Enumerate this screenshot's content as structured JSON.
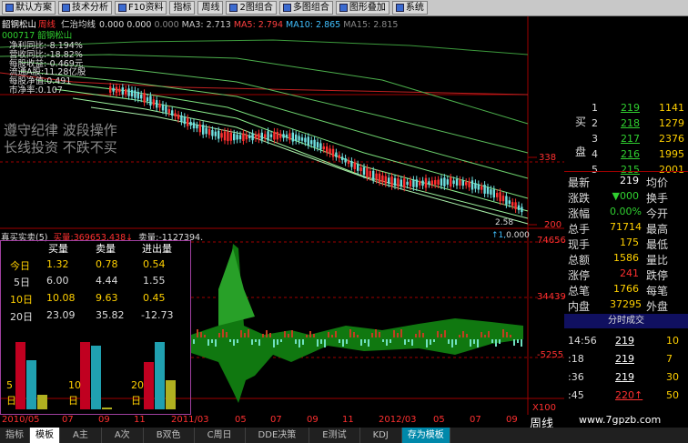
{
  "toolbar": {
    "items": [
      "默认方案",
      "技术分析",
      "F10资料",
      "指标",
      "周线",
      "2图组合",
      "多图组合",
      "图形叠加",
      "系统"
    ]
  },
  "header": {
    "name": "韶钢松山",
    "period": "周线",
    "ma_label": "仁治均线",
    "v1": "0.000",
    "v2": "0.000",
    "v3": "0.000",
    "ma3": "MA3: 2.713",
    "ma5": "MA5: 2.794",
    "ma10": "MA10: 2.865",
    "ma15": "MA15: 2.815"
  },
  "subheader": {
    "code": "000717",
    "name": "韶钢松山"
  },
  "fundamentals": [
    "净利同比:-8.194%",
    "营收同比:-18.82%",
    "每股收益:-0.469元",
    "流通A股:11.28亿股",
    "每股净值:0.491",
    "市净率:0.107"
  ],
  "watermark": {
    "line1": "遵守纪律 波段操作",
    "line2": "长线投资 不跌不买"
  },
  "price_axis": {
    "p338": "338",
    "p200": "200",
    "p74656": "74656",
    "p34439": "34439",
    "pneg": "-5255",
    "x100": "X100"
  },
  "mid_labels": {
    "a": "2.58",
    "b": "0.000"
  },
  "buysell": {
    "title": "真买实卖(5)",
    "buy_label": "买量:",
    "buy_val": "369653.438↓",
    "sell_label": "卖量:",
    "sell_val": "-1127394.",
    "headers": [
      "买量",
      "卖量",
      "进出量"
    ],
    "rows": [
      {
        "label": "今日",
        "buy": "1.32",
        "sell": "0.78",
        "net": "0.54"
      },
      {
        "label": "5日",
        "buy": "6.00",
        "sell": "4.44",
        "net": "1.55"
      },
      {
        "label": "10日",
        "buy": "10.08",
        "sell": "9.63",
        "net": "0.45"
      },
      {
        "label": "20日",
        "buy": "23.09",
        "sell": "35.82",
        "net": "-12.73"
      }
    ],
    "bar_labels": [
      {
        "n": "5",
        "d": "日"
      },
      {
        "n": "10",
        "d": "日"
      },
      {
        "n": "20",
        "d": "日"
      }
    ]
  },
  "orderbook": {
    "buy_label": "买",
    "pan_label": "盘",
    "rows": [
      {
        "n": "1",
        "price": "219",
        "vol": "1141"
      },
      {
        "n": "2",
        "price": "218",
        "vol": "1279"
      },
      {
        "n": "3",
        "price": "217",
        "vol": "2376"
      },
      {
        "n": "4",
        "price": "216",
        "vol": "1995"
      },
      {
        "n": "5",
        "price": "215",
        "vol": "2001"
      }
    ]
  },
  "quote": [
    {
      "l": "最新",
      "v": "219",
      "r": "均价"
    },
    {
      "l": "涨跌",
      "v": "▼000",
      "r": "换手"
    },
    {
      "l": "涨幅",
      "v": "0.00%",
      "r": "今开"
    },
    {
      "l": "总手",
      "v": "71714",
      "r": "最高"
    },
    {
      "l": "现手",
      "v": "175",
      "r": "最低"
    },
    {
      "l": "总额",
      "v": "1586",
      "r": "量比"
    },
    {
      "l": "涨停",
      "v": "241",
      "r": "跌停"
    },
    {
      "l": "总笔",
      "v": "1766",
      "r": "每笔"
    },
    {
      "l": "内盘",
      "v": "37295",
      "r": "外盘"
    }
  ],
  "ticks": {
    "title": "分时成交",
    "rows": [
      {
        "t": "14:56",
        "p": "219",
        "v": "10"
      },
      {
        "t": ":18",
        "p": "219",
        "v": "7"
      },
      {
        "t": ":36",
        "p": "219",
        "v": "30"
      },
      {
        "t": ":45",
        "p": "220↑",
        "v": "50"
      }
    ]
  },
  "time_axis": [
    "2010/05",
    "07",
    "09",
    "11",
    "2011/03",
    "05",
    "07",
    "09",
    "11",
    "2012/03",
    "05",
    "07",
    "09"
  ],
  "zhouxian": "周线",
  "website": "www.7gpzb.com",
  "tabs": [
    "指标",
    "模板",
    "A主",
    "A次",
    "B双色",
    "C周日",
    "DDE决策",
    "E测试",
    "KDJ",
    "存为模板"
  ]
}
